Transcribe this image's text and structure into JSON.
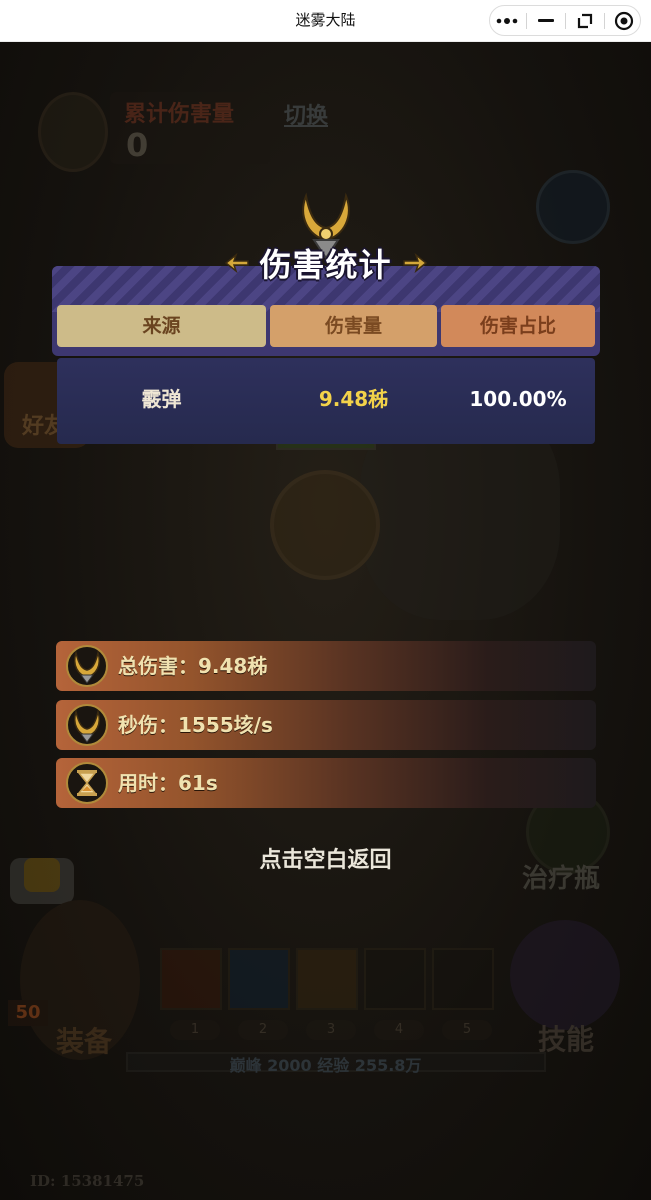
{
  "window": {
    "title": "迷雾大陆"
  },
  "capsule": {
    "more_icon": "more-dots-icon",
    "minimize_icon": "minimize-icon",
    "restore_icon": "restore-icon",
    "close_icon": "target-circle-icon"
  },
  "background": {
    "cumulative_damage_label": "累计伤害量",
    "cumulative_damage_value": "0",
    "switch_label": "切换",
    "friend_label": "好友",
    "potion_label": "治疗瓶",
    "equip_label": "装备",
    "skill_label": "技能",
    "hero_level": "50",
    "skill_slot_numbers": [
      "1",
      "2",
      "3",
      "4",
      "5"
    ],
    "xp_text": "巅峰 2000   经验 255.8万",
    "player_id": "ID: 15381475"
  },
  "popup": {
    "title": "伤害统计",
    "columns": {
      "source": "来源",
      "damage": "伤害量",
      "share": "伤害占比"
    },
    "rows": [
      {
        "source": "霰弹",
        "damage": "9.48秭",
        "share": "100.00%"
      }
    ],
    "summary": {
      "total_damage": "总伤害：9.48秭",
      "dps": "秒伤：1555垓/s",
      "time": "用时：61s"
    },
    "back_hint": "点击空白返回"
  },
  "colors": {
    "header_purple": "#3d3770",
    "col_source": "#cdbb89",
    "col_damage": "#d4a06a",
    "col_share": "#d2895a",
    "damage_value": "#f2d24a"
  }
}
